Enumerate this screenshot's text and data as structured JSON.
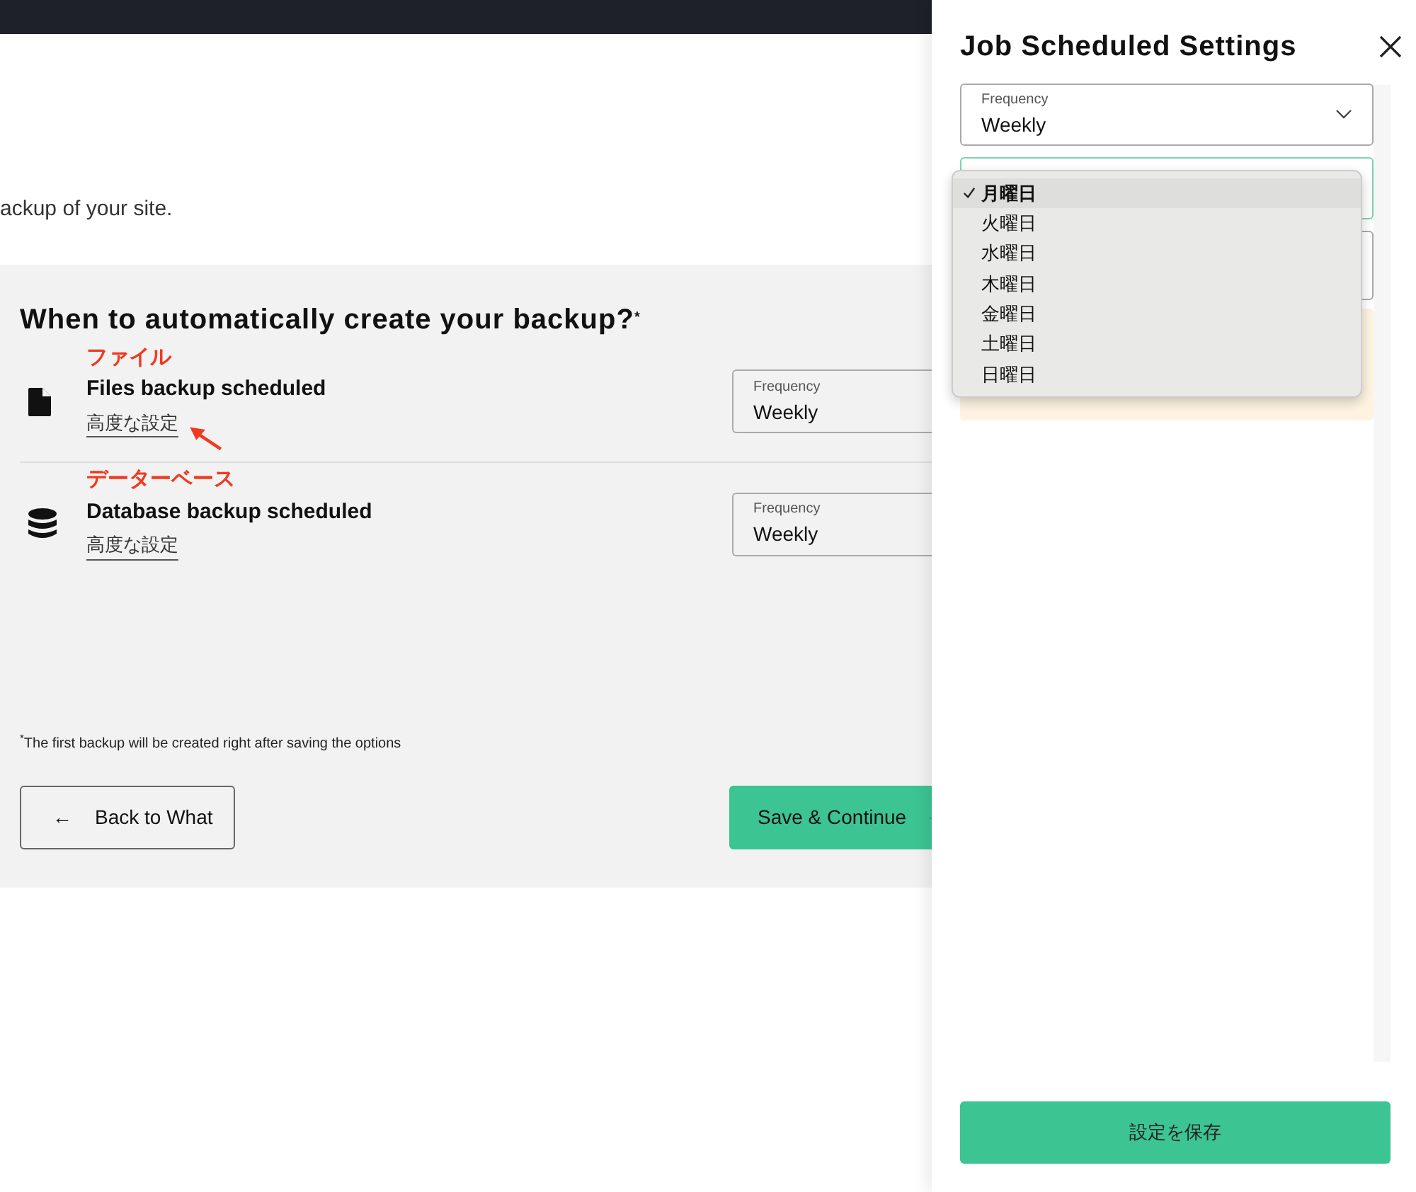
{
  "intro_text": "ackup of your site.",
  "panel": {
    "heading": "When to automatically create your backup?",
    "heading_mark": "*",
    "rows": [
      {
        "kind": "files",
        "annotation": "ファイル",
        "title": "Files backup scheduled",
        "link": "高度な設定",
        "arrow": true,
        "select": {
          "label": "Frequency",
          "value": "Weekly"
        }
      },
      {
        "kind": "database",
        "annotation": "データーベース",
        "title": "Database backup scheduled",
        "link": "高度な設定",
        "arrow": false,
        "select": {
          "label": "Frequency",
          "value": "Weekly"
        }
      }
    ],
    "footnote": "$^{*}$The first backup will be created right after saving the options",
    "back_button": {
      "arrow": "←",
      "label": "Back to What"
    },
    "continue_button": {
      "label": "Save & Continue"
    }
  },
  "drawer": {
    "title": "Job Scheduled Settings",
    "frequency": {
      "label": "Frequency",
      "value": "Weekly"
    },
    "day_options": [
      {
        "label": "月曜日",
        "selected": true
      },
      {
        "label": "火曜日",
        "selected": false
      },
      {
        "label": "水曜日",
        "selected": false
      },
      {
        "label": "木曜日",
        "selected": false
      },
      {
        "label": "金曜日",
        "selected": false
      },
      {
        "label": "土曜日",
        "selected": false
      },
      {
        "label": "日曜日",
        "selected": false
      }
    ],
    "save_button": "設定を保存"
  }
}
